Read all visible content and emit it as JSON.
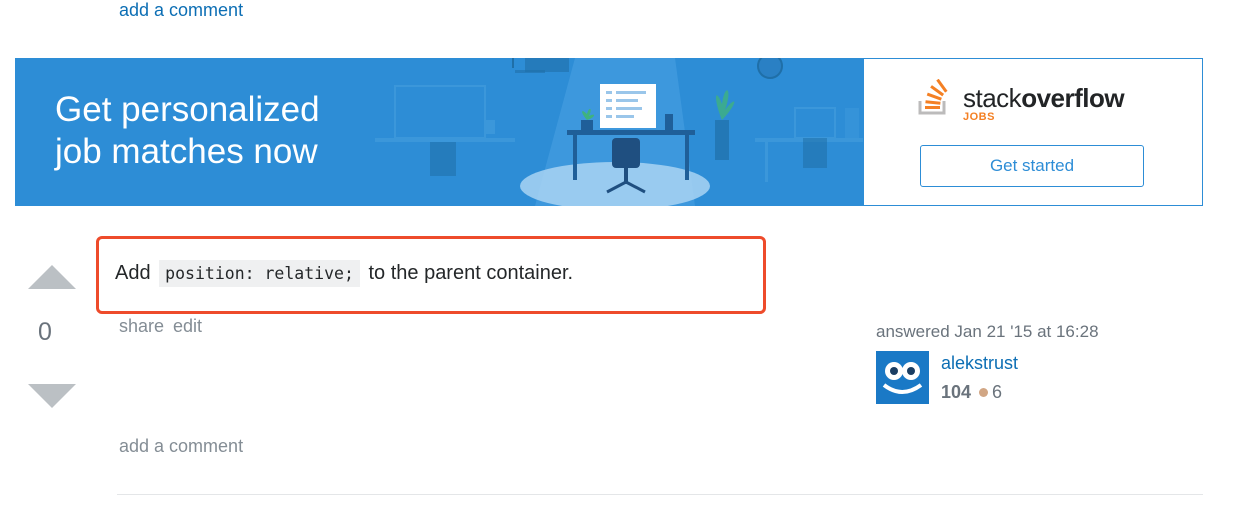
{
  "top_comment_link": "add a comment",
  "banner": {
    "headline_line1": "Get personalized",
    "headline_line2": "job matches now",
    "logo_text_regular": "stack",
    "logo_text_bold": "overflow",
    "logo_sub": "JOBS",
    "cta_label": "Get started",
    "bg_color": "#2d8dd6",
    "accent_color": "#f48024"
  },
  "answer": {
    "text_before": "Add",
    "code": "position: relative;",
    "text_after": "to the parent container.",
    "vote_count": "0",
    "share_label": "share",
    "edit_label": "edit",
    "answered_text": "answered Jan 21 '15 at 16:28",
    "user_name": "alekstrust",
    "user_rep": "104",
    "bronze_badges": "6",
    "add_comment_label": "add a comment",
    "highlight_color": "#ee4b2b"
  }
}
